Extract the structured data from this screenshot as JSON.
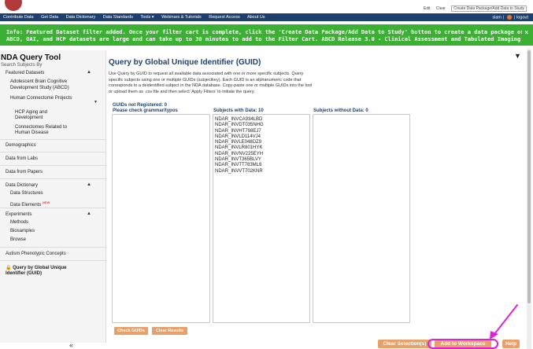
{
  "top": {
    "edit": "Edit",
    "clear": "Clear",
    "package_input": "Create Data Package/Add Data to Study"
  },
  "nav": {
    "items": [
      "Contribute Data",
      "Get Data",
      "Data Dictionary",
      "Data Standards",
      "Tools ▾",
      "Webinars & Tutorials",
      "Request Access",
      "About Us"
    ],
    "user": "slam",
    "logout": "logout"
  },
  "banner": {
    "line1": "Info: Featured Dataset filter added. Once your filter cart is complete, click the 'Create Data Package/Add Data to Study' button to create a data package or add data to an NDA Study.",
    "line2": "ABCD, OAI, and HCP datasets are large and can take up to 30 minutes to add to the Filter Cart. ABCD Release 3.0 - Clinical Assessment and Tabulated Imaging Data will take the longest.",
    "close": "×"
  },
  "sidebar": {
    "title": "NDA Query Tool",
    "subtitle": "Search Subjects By",
    "featured": "Featured Datasets",
    "featured_items": [
      "Adolescent Brain Cognitive",
      "Development Study (ABCD)",
      "Human Connectome Projects",
      "HCP Aging and",
      "Development",
      "Connectomes Related to",
      "Human Disease"
    ],
    "demographics": "Demographics",
    "labs": "Data from Labs",
    "papers": "Data from Papers",
    "dictionary": "Data Dictionary",
    "structures": "Data Structures",
    "elements": "Data Elements",
    "new_badge": "NEW",
    "experiments": "Experiments",
    "methods": "Methods",
    "biosamples": "Biosamples",
    "browse": "Browse",
    "autism": "Autism Phenotypic Concepts",
    "guid_query_1": "🔒 Query by Global Unique",
    "guid_query_2": "Identifier (GUID)",
    "collapse": "«"
  },
  "main": {
    "title": "Query by Global Unique Identifier (GUID)",
    "description": "Use Query by GUID to request all available data associated with one or more specific subjects. Query specific subjects using one or multiple GUIDs (subjectkey). Each GUID is an alphanumeric code that corresponds to a deidentified subject in the NDA database. Copy-paste one or multiple GUIDs into the tool or upload them as .csv file and then select 'Apply Filters' to initiate the query.",
    "not_registered": "GUIDs not Registered: 0",
    "check_grammar": "Please check grammar/typos",
    "with_data": "Subjects with Data: 10",
    "without_data": "Subjects without Data: 0",
    "guids": [
      "NDAR_INVCA934LBD",
      "NDAR_INVDT035NHG",
      "NDAR_INVHT798EJ7",
      "NDAR_INVLD114VJ4",
      "NDAR_INVLE048DZ9",
      "NDAR_INVLR801HYK",
      "NDAR_INVNV225EYH",
      "NDAR_INVT365BLVY",
      "NDAR_INVTT783ML6",
      "NDAR_INVVT702KNR"
    ],
    "check_button": "Check GUIDs",
    "clear_results": "Clear Results"
  },
  "footer": {
    "clear_selection": "Clear Selection(s)",
    "add_workspace": "Add to Workspace",
    "help": "Help"
  },
  "colors": {
    "nav": "#1f3f6e",
    "banner": "#3bb032",
    "button": "#e8a06a",
    "highlight": "#e022d6"
  }
}
